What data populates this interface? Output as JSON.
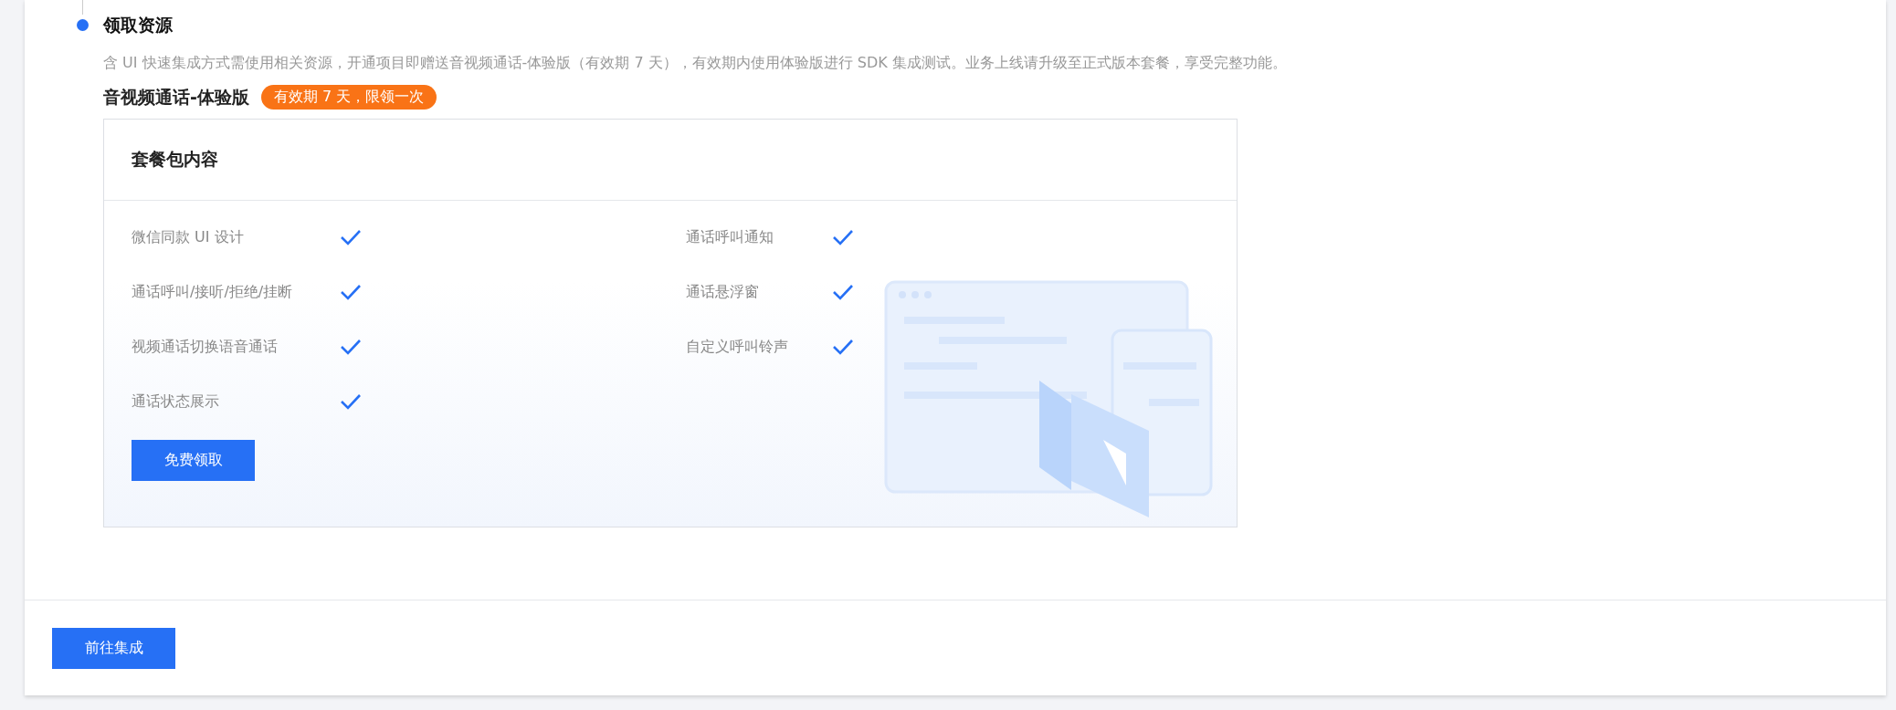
{
  "step": {
    "title": "领取资源",
    "description": "含 UI 快速集成方式需使用相关资源，开通项目即赠送音视频通话-体验版（有效期 7 天），有效期内使用体验版进行 SDK 集成测试。业务上线请升级至正式版本套餐，享受完整功能。"
  },
  "package": {
    "name": "音视频通话-体验版",
    "badge": "有效期 7 天，限领一次",
    "card_title": "套餐包内容",
    "features": [
      {
        "label": "微信同款 UI 设计",
        "checked": true
      },
      {
        "label": "通话呼叫通知",
        "checked": true
      },
      {
        "label": "通话呼叫/接听/拒绝/挂断",
        "checked": true
      },
      {
        "label": "通话悬浮窗",
        "checked": true
      },
      {
        "label": "视频通话切换语音通话",
        "checked": true
      },
      {
        "label": "自定义呼叫铃声",
        "checked": true
      },
      {
        "label": "通话状态展示",
        "checked": true
      }
    ],
    "button": "免费领取"
  },
  "footer": {
    "button": "前往集成"
  }
}
